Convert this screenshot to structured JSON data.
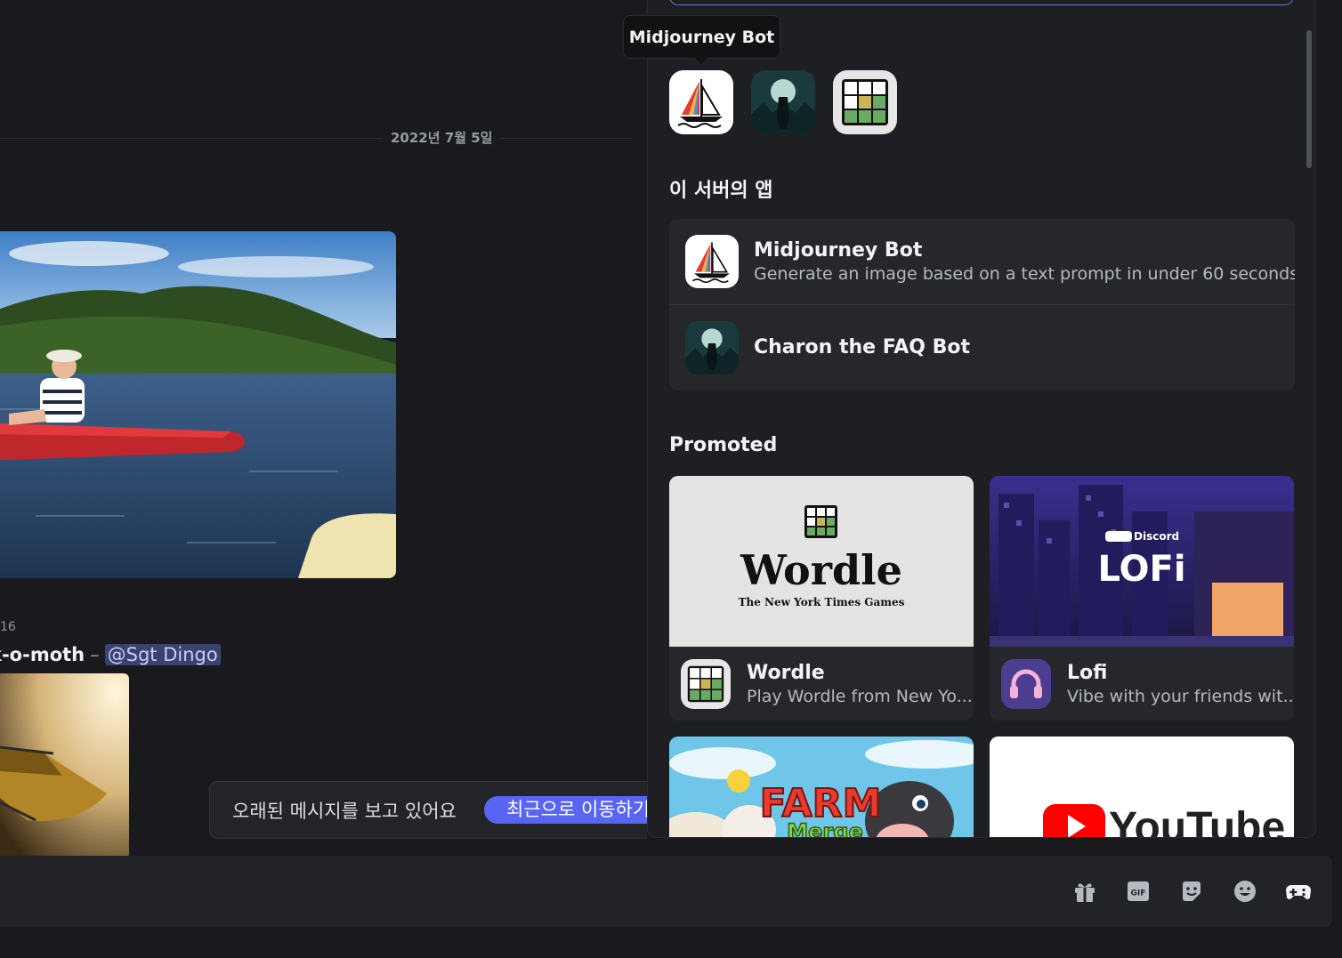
{
  "chat": {
    "date_divider": "2022년 7월 5일",
    "message_time": "16",
    "author": "k-o-moth",
    "separator": "–",
    "mention": "@Sgt Dingo",
    "old_messages_banner": "오래된 메시지를 보고 있어요",
    "jump_button": "최근으로 이동하기"
  },
  "tooltip": "Midjourney Bot",
  "launcher": {
    "recent_apps": [
      {
        "name": "Midjourney Bot",
        "icon": "sailboat-icon"
      },
      {
        "name": "Charon the FAQ Bot",
        "icon": "figure-moon-icon"
      },
      {
        "name": "Wordle",
        "icon": "wordle-grid-icon"
      }
    ],
    "server_apps_title": "이 서버의 앱",
    "server_apps": [
      {
        "name": "Midjourney Bot",
        "description": "Generate an image based on a text prompt in under 60 seconds ..."
      },
      {
        "name": "Charon the FAQ Bot",
        "description": ""
      }
    ],
    "promoted_title": "Promoted",
    "promoted": [
      {
        "name": "Wordle",
        "description": "Play Wordle from New Yo...",
        "banner_title": "Wordle",
        "banner_sub": "The New York Times Games"
      },
      {
        "name": "Lofi",
        "description": "Vibe with your friends wit...",
        "banner_brand": "Discord",
        "banner_title": "LOFi"
      },
      {
        "name": "Farm Merge",
        "banner_title": "FARM",
        "banner_sub": "Merge"
      },
      {
        "name": "YouTube",
        "banner_title": "YouTube"
      }
    ]
  },
  "composer": {
    "icons": [
      "gift-icon",
      "gif-icon",
      "sticker-icon",
      "emoji-icon",
      "activities-icon"
    ],
    "gif_label": "GIF"
  },
  "colors": {
    "background": "#1a1a1e",
    "panel": "#26272b",
    "accent": "#5865f2",
    "mention_bg": "#3c4270"
  }
}
